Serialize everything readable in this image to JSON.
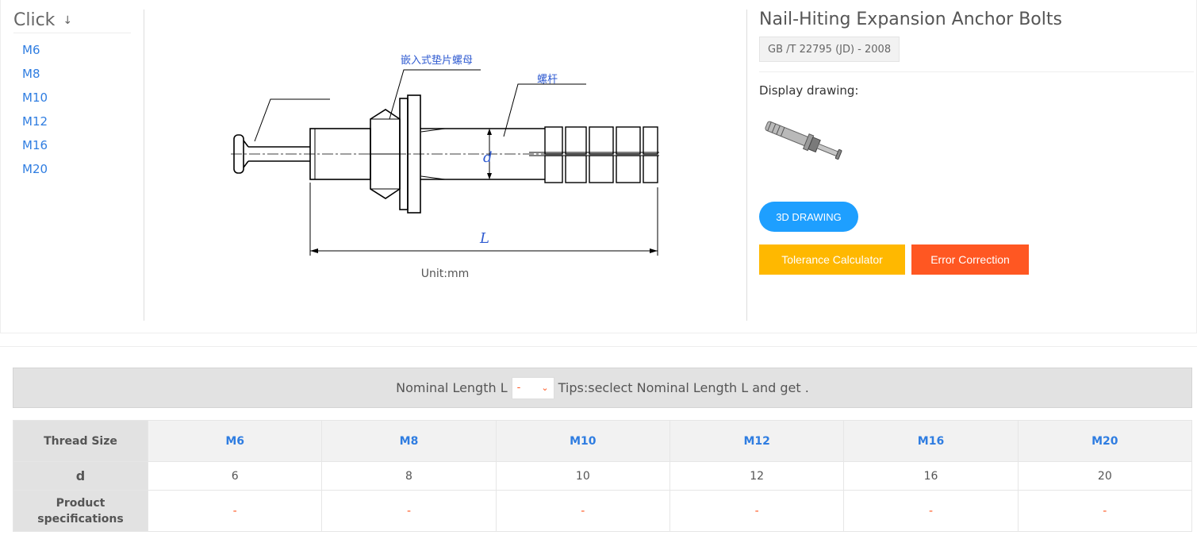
{
  "sizes_nav": {
    "title": "Click",
    "items": [
      "M6",
      "M8",
      "M10",
      "M12",
      "M16",
      "M20"
    ]
  },
  "drawing": {
    "label_washer_nut": "嵌入式垫片螺母",
    "label_screw": "螺杆",
    "label_d": "d",
    "label_L": "L",
    "unit": "Unit:mm"
  },
  "product": {
    "title": "Nail-Hiting Expansion Anchor Bolts",
    "standard": "GB /T 22795 (JD) - 2008",
    "display_label": "Display drawing:",
    "btn_3d": "3D DRAWING",
    "btn_tolerance": "Tolerance Calculator",
    "btn_error": "Error Correction"
  },
  "length_filter": {
    "label": "Nominal Length L",
    "selected": "-",
    "tips": "Tips:seclect Nominal Length L and get ."
  },
  "table": {
    "header_label": "Thread Size",
    "columns": [
      "M6",
      "M8",
      "M10",
      "M12",
      "M16",
      "M20"
    ],
    "d_label": "d",
    "d_values": [
      "6",
      "8",
      "10",
      "12",
      "16",
      "20"
    ],
    "spec_label": "Product specifications",
    "spec_values": [
      "-",
      "-",
      "-",
      "-",
      "-",
      "-"
    ]
  },
  "colors": {
    "link": "#2f7de1",
    "btn_3d": "#1e9fff",
    "btn_tolerance": "#ffb800",
    "btn_error": "#ff5722"
  }
}
